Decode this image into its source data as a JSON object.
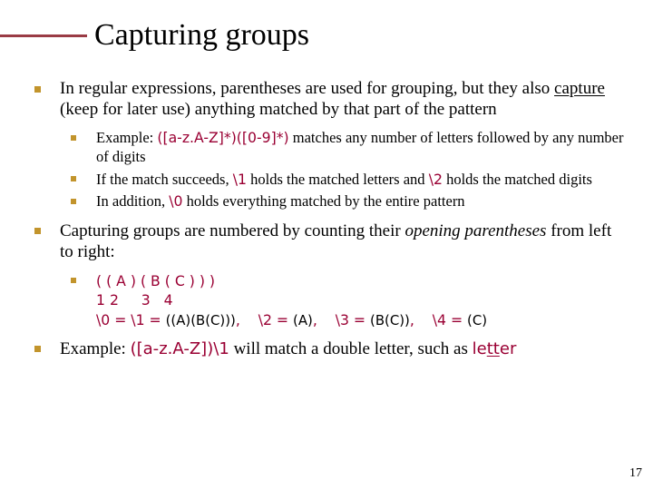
{
  "title": "Capturing groups",
  "p1a": "In regular expressions, parentheses are used for grouping, but they also ",
  "p1b": "capture",
  "p1c": " (keep for later use) anything matched by that part of the pattern",
  "sub1a": "Example: ",
  "sub1b": "([a-z.A-Z]*)([0-9]*)",
  "sub1c": " matches any number of letters followed by any number of digits",
  "sub2a": "If the match succeeds, ",
  "sub2b": "\\1",
  "sub2c": " holds the matched letters and ",
  "sub2d": "\\2",
  "sub2e": " holds the matched digits",
  "sub3a": "In addition, ",
  "sub3b": "\\0",
  "sub3c": " holds everything matched by the entire pattern",
  "p2a": "Capturing groups are numbered by counting their ",
  "p2b": "opening parentheses",
  "p2c": " from left to right:",
  "codeL1": "( ( A ) ( B ( C ) ) )",
  "codeL2": "1 2     3   4",
  "codeL3a": "\\0 = \\1 = ",
  "codeL3b": "((A)(B(C)))",
  "codeL3c": ",    ",
  "codeL3d": "\\2 = ",
  "codeL3e": "(A)",
  "codeL3f": ",    ",
  "codeL3g": "\\3 = ",
  "codeL3h": "(B(C))",
  "codeL3i": ",    ",
  "codeL3j": "\\4 = ",
  "codeL3k": "(C)",
  "p3a": "Example: ",
  "p3b": "([a-z.A-Z])\\1",
  "p3c": " will match a double letter, such as ",
  "p3d": "le",
  "p3e": "tt",
  "p3f": "er",
  "pageNum": "17"
}
